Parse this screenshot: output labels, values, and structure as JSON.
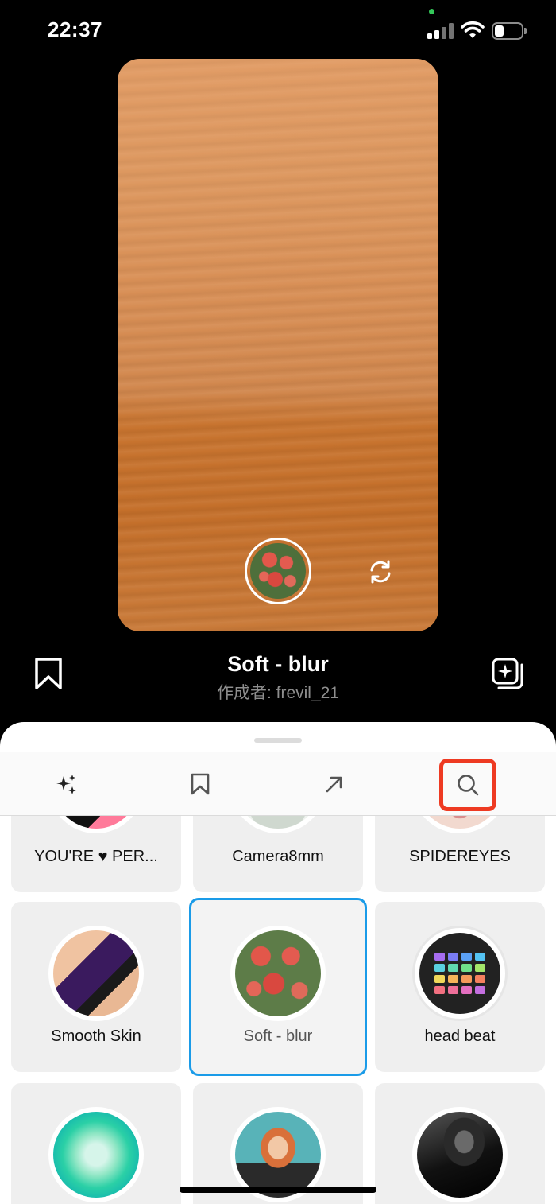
{
  "status_bar": {
    "time": "22:37",
    "icons": [
      "signal-icon",
      "wifi-icon",
      "battery-icon"
    ]
  },
  "effect": {
    "title": "Soft - blur",
    "author": "作成者: frevil_21",
    "save_icon": "bookmark-icon",
    "add_icon": "add-to-collection-icon"
  },
  "camera": {
    "capture_icon": "capture-thumbnail",
    "flip_icon": "flip-camera-icon"
  },
  "sheet": {
    "tabs": [
      {
        "icon": "sparkles-icon"
      },
      {
        "icon": "bookmark-icon"
      },
      {
        "icon": "arrow-up-right-icon"
      },
      {
        "icon": "search-icon"
      }
    ],
    "effects": [
      {
        "name": "YOU'RE ♥ PER..."
      },
      {
        "name": "Camera8mm"
      },
      {
        "name": "SPIDEREYES"
      },
      {
        "name": "Smooth Skin"
      },
      {
        "name": "Soft - blur"
      },
      {
        "name": "head beat"
      },
      {
        "name": ""
      },
      {
        "name": ""
      },
      {
        "name": ""
      }
    ]
  },
  "colors": {
    "selected_border": "#1a9be8",
    "search_highlight": "#ee3a22",
    "preview_orange": "#d1874d"
  }
}
